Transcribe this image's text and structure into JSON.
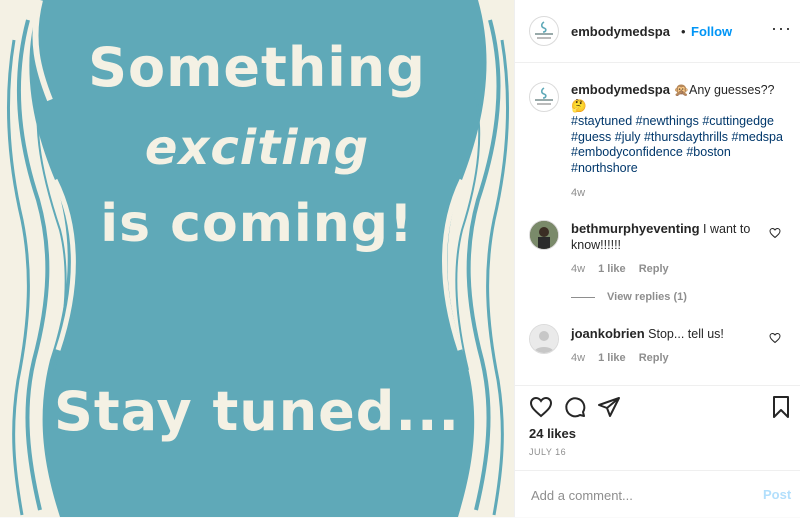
{
  "image": {
    "line1": "Something",
    "line2": "exciting",
    "line3": "is coming!",
    "line4": "Stay tuned...",
    "background_color": "#5fa9b8",
    "text_color": "#f4f1e4"
  },
  "header": {
    "username": "embodymedspa",
    "separator": "•",
    "follow_label": "Follow",
    "more_icon": "more-options-icon",
    "more_label": "···"
  },
  "caption": {
    "username": "embodymedspa",
    "text": " 🙊Any guesses?? 🤔",
    "hashtags": "#staytuned #newthings #cuttingedge #guess #july #thursdaythrills #medspa #embodyconfidence #boston #northshore",
    "time": "4w"
  },
  "comments": [
    {
      "username": "bethmurphyeventing",
      "text": " I want to know!!!!!!",
      "time": "4w",
      "likes": "1 like",
      "reply": "Reply",
      "view_replies": "View replies (1)"
    },
    {
      "username": "joankobrien",
      "text": " Stop... tell us!",
      "time": "4w",
      "likes": "1 like",
      "reply": "Reply"
    }
  ],
  "actions": {
    "icons": [
      "heart-icon",
      "comment-icon",
      "share-icon",
      "bookmark-icon"
    ]
  },
  "likes": "24 likes",
  "date": "JULY 16",
  "add_comment": {
    "placeholder": "Add a comment...",
    "post_label": "Post"
  },
  "colors": {
    "follow": "#0095f6",
    "hashtag": "#00376b",
    "muted": "#8e8e8e",
    "post_disabled": "#b2dffc"
  }
}
